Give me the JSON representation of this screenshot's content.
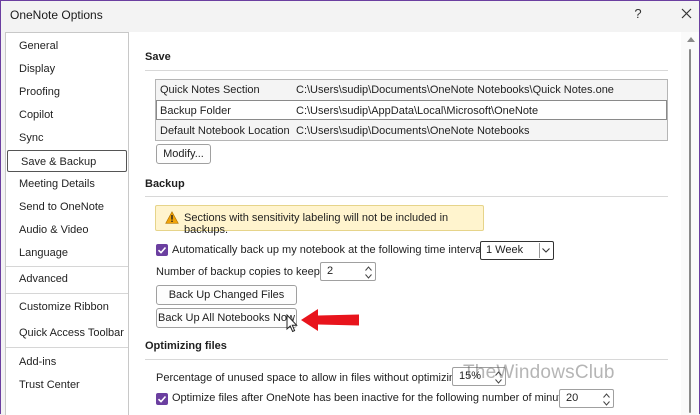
{
  "window": {
    "title": "OneNote Options",
    "help": "?"
  },
  "sidebar": {
    "items": [
      {
        "label": "General"
      },
      {
        "label": "Display"
      },
      {
        "label": "Proofing"
      },
      {
        "label": "Copilot"
      },
      {
        "label": "Sync"
      },
      {
        "label": "Save & Backup"
      },
      {
        "label": "Meeting Details"
      },
      {
        "label": "Send to OneNote"
      },
      {
        "label": "Audio & Video"
      },
      {
        "label": "Language"
      },
      {
        "label": "Advanced"
      },
      {
        "label": "Customize Ribbon"
      },
      {
        "label": "Quick Access Toolbar"
      },
      {
        "label": "Add-ins"
      },
      {
        "label": "Trust Center"
      }
    ],
    "selected": "Save & Backup"
  },
  "save": {
    "title": "Save",
    "locations": [
      {
        "name": "Quick Notes Section",
        "path": "C:\\Users\\sudip\\Documents\\OneNote Notebooks\\Quick Notes.one"
      },
      {
        "name": "Backup Folder",
        "path": "C:\\Users\\sudip\\AppData\\Local\\Microsoft\\OneNote"
      },
      {
        "name": "Default Notebook Location",
        "path": "C:\\Users\\sudip\\Documents\\OneNote Notebooks"
      }
    ],
    "modify_label": "Modify..."
  },
  "backup": {
    "title": "Backup",
    "warning": "Sections with sensitivity labeling will not be included in backups.",
    "auto_backup_label": "Automatically back up my notebook at the following time interval:",
    "interval_value": "1 Week",
    "copies_label": "Number of backup copies to keep:",
    "copies_value": "2",
    "changed_files_label": "Back Up Changed Files Now",
    "all_notebooks_label": "Back Up All Notebooks Now"
  },
  "optimizing": {
    "title": "Optimizing files",
    "unused_space_label": "Percentage of unused space to allow in files without optimizing:",
    "unused_space_value": "15%",
    "optimize_label": "Optimize files after OneNote has been inactive for the following number of minutes:",
    "optimize_value": "20"
  },
  "watermark": "TheWindowsClub",
  "colors": {
    "accent": "#6b3fa0",
    "arrow": "#e8141c",
    "warning_bg": "#fff4ce"
  }
}
